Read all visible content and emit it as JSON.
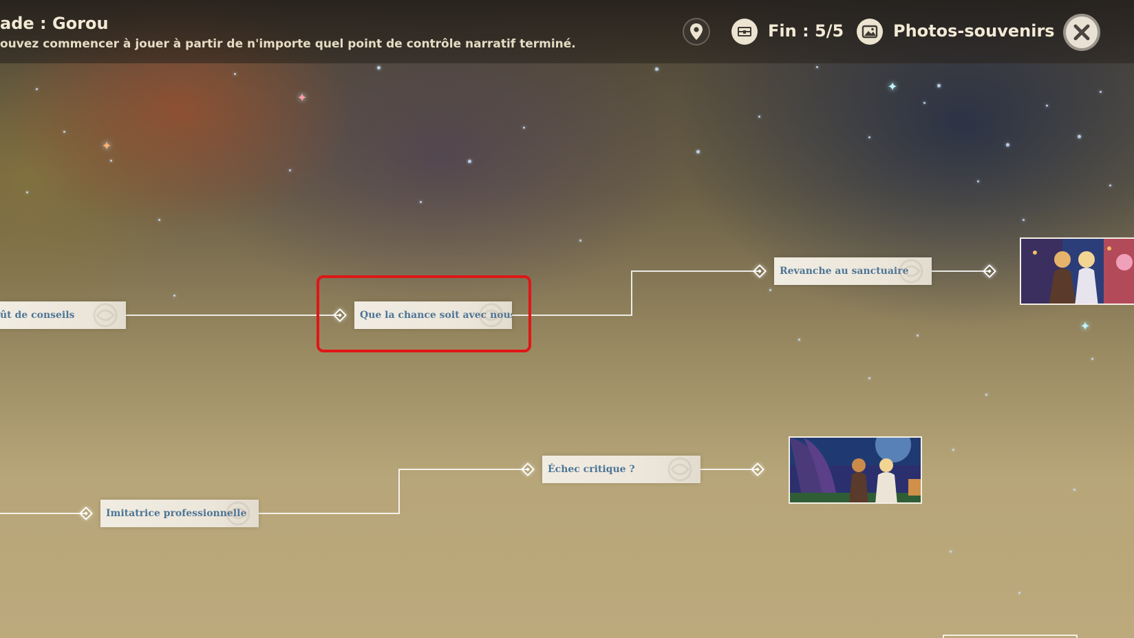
{
  "header": {
    "title": "ade : Gorou",
    "subtitle": "ouvez commencer à jouer à partir de n'importe quel point de contrôle narratif terminé.",
    "location_icon": "location-pin-icon",
    "ending_icon": "chest-icon",
    "ending_label": "Fin : 5/5",
    "photos_icon": "photo-icon",
    "photos_label": "Photos-souvenirs",
    "close_icon": "close-icon"
  },
  "map": {
    "nodes": [
      {
        "id": "fut-de-conseils",
        "label": "ût de conseils"
      },
      {
        "id": "que-la-chance",
        "label": "Que la chance soit avec nous",
        "highlighted": true
      },
      {
        "id": "revanche-au-sanctuaire",
        "label": "Revanche au sanctuaire"
      },
      {
        "id": "echec-critique",
        "label": "Échec critique ?"
      },
      {
        "id": "imitatrice-professionnelle",
        "label": "Imitatrice professionnelle"
      }
    ],
    "ending_photos": [
      {
        "id": "ending-photo-1",
        "subject": "festival night photo"
      },
      {
        "id": "ending-photo-2",
        "subject": "tree night photo"
      },
      {
        "id": "ending-photo-3",
        "subject": "partial photo"
      }
    ]
  },
  "colors": {
    "highlight": "#e01616",
    "node_text": "#4e7595",
    "node_bg": "#f1ece2",
    "line": "#ffffff"
  }
}
